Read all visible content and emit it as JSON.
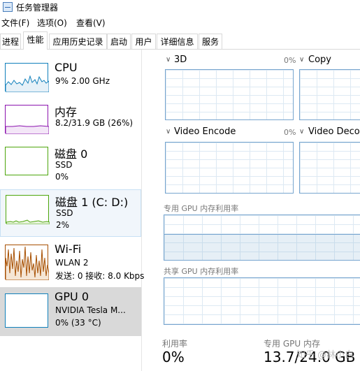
{
  "window": {
    "title": "任务管理器"
  },
  "menu": [
    "文件(F)",
    "选项(O)",
    "查看(V)"
  ],
  "tabs": [
    {
      "label": "进程",
      "active": false
    },
    {
      "label": "性能",
      "active": true
    },
    {
      "label": "应用历史记录",
      "active": false
    },
    {
      "label": "启动",
      "active": false
    },
    {
      "label": "用户",
      "active": false
    },
    {
      "label": "详细信息",
      "active": false
    },
    {
      "label": "服务",
      "active": false
    }
  ],
  "sidebar": {
    "items": [
      {
        "name": "CPU",
        "line1": "9% 2.00 GHz",
        "line2": "",
        "color": "#1180bb",
        "icon": "cpu-sparkline"
      },
      {
        "name": "内存",
        "line1": "8.2/31.9 GB (26%)",
        "line2": "",
        "color": "#8b12ae",
        "icon": "memory-sparkline"
      },
      {
        "name": "磁盘 0",
        "line1": "SSD",
        "line2": "0%",
        "color": "#4da60c",
        "icon": "disk-sparkline"
      },
      {
        "name": "磁盘 1 (C: D:)",
        "line1": "SSD",
        "line2": "2%",
        "color": "#4da60c",
        "icon": "disk-sparkline"
      },
      {
        "name": "Wi-Fi",
        "line1": "WLAN 2",
        "line2": "发送: 0 接收: 8.0 Kbps",
        "color": "#a74f01",
        "icon": "network-sparkline"
      },
      {
        "name": "GPU 0",
        "line1": "NVIDIA Tesla M...",
        "line2": "0% (33 °C)",
        "color": "#1180bb",
        "icon": "gpu-sparkline"
      }
    ]
  },
  "gpu": {
    "engines": [
      {
        "label": "3D",
        "percent": "0%"
      },
      {
        "label": "Copy",
        "percent": ""
      },
      {
        "label": "Video Encode",
        "percent": "0%"
      },
      {
        "label": "Video Decoc",
        "percent": ""
      }
    ],
    "dedicated_label": "专用 GPU 内存利用率",
    "shared_label": "共享 GPU 内存利用率",
    "dedicated_fill_fraction": 0.57,
    "stats": {
      "utilization_label": "利用率",
      "utilization_value": "0%",
      "dedicated_label": "专用 GPU 内存",
      "dedicated_value": "13.7/24.0 GB"
    },
    "accent": "#77a5cf"
  },
  "watermark": "知乎 @林小白"
}
